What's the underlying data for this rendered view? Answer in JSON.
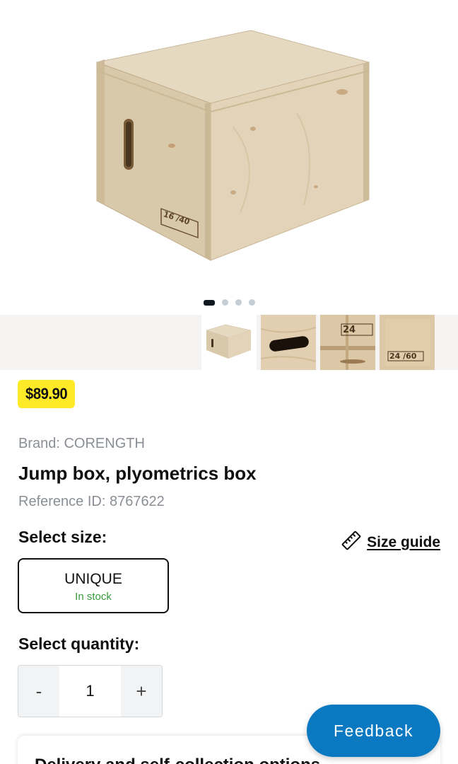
{
  "gallery": {
    "main_image_alt": "plyo-box-photo",
    "dots": [
      true,
      false,
      false,
      false
    ],
    "thumbnails": [
      "box-thumb",
      "handle-thumb",
      "label-24-thumb",
      "label-24-60-thumb"
    ]
  },
  "product": {
    "price": "$89.90",
    "brand": "Brand: CORENGTH",
    "title": "Jump box, plyometrics box",
    "reference": "Reference ID: 8767622"
  },
  "size": {
    "label": "Select size:",
    "guide_label": "Size guide",
    "option_name": "UNIQUE",
    "option_stock": "In stock"
  },
  "quantity": {
    "label": "Select quantity:",
    "minus": "-",
    "value": "1",
    "plus": "+"
  },
  "delivery": {
    "heading": "Delivery and self-collection options"
  },
  "feedback": {
    "label": "Feedback"
  },
  "colors": {
    "price_bg": "#ffea28",
    "feedback_bg": "#0a79c1",
    "stock_green": "#3a9a3e"
  }
}
